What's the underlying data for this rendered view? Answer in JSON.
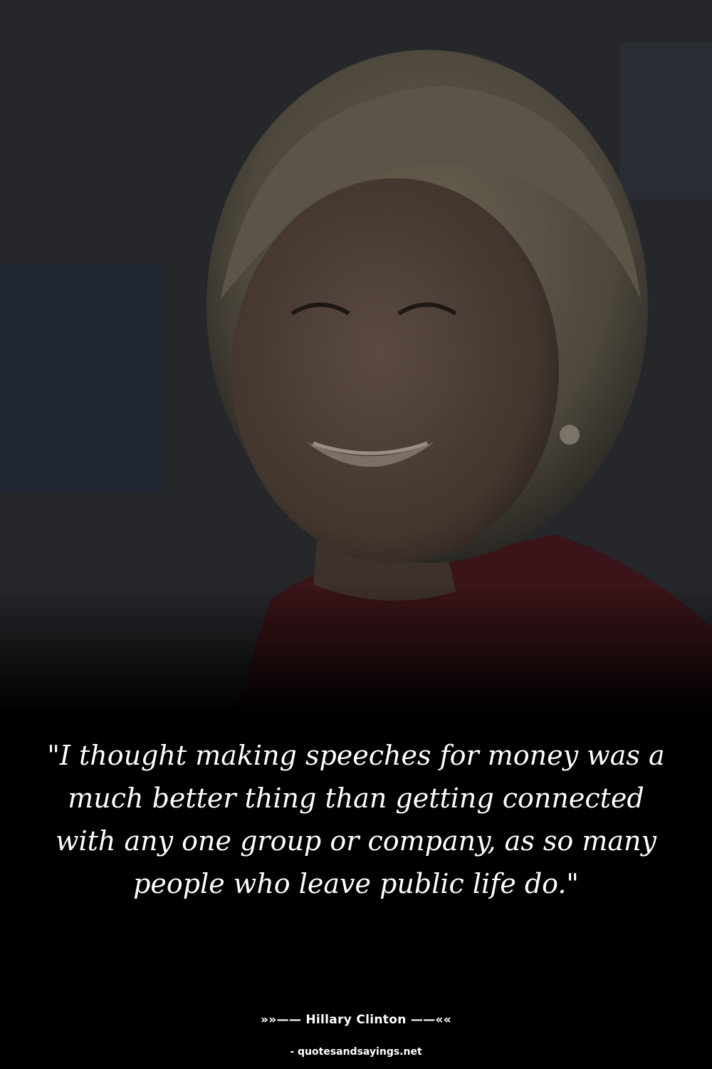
{
  "quote": {
    "text": "\"I thought making speeches for money was a much better thing than getting connected with any one group or company, as so many people who leave public life do.\""
  },
  "attribution": {
    "prefix": "»»—— ",
    "author": "Hillary Clinton",
    "suffix": " ——««"
  },
  "source": {
    "text": "- quotesandsayings.net"
  },
  "colors": {
    "background": "#000000",
    "text": "#ffffff",
    "jacket": "#3a1418",
    "hair": "#5d5546",
    "skin": "#4a3d36"
  }
}
